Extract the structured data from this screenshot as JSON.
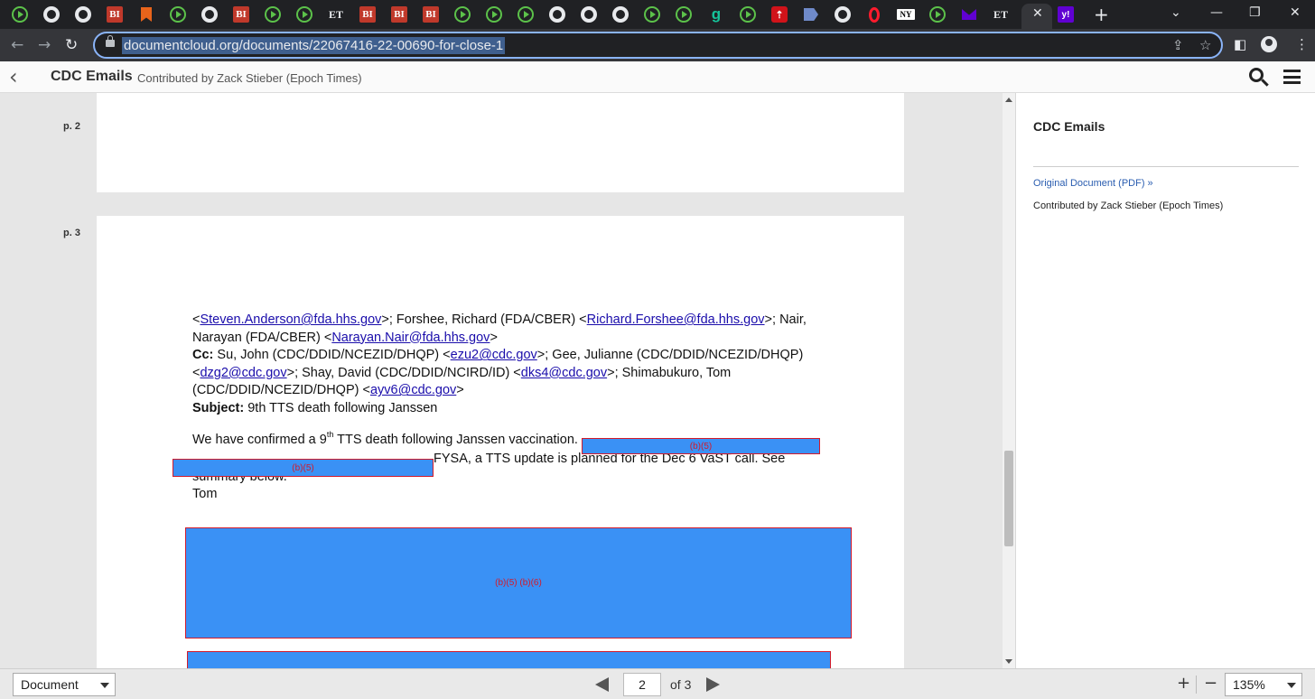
{
  "browser": {
    "url": "documentcloud.org/documents/22067416-22-00690-for-close-1",
    "tab_favicons": [
      "play",
      "globe",
      "globe",
      "bi",
      "bookmark",
      "play",
      "globe",
      "bi",
      "play",
      "play",
      "et",
      "bi",
      "bi",
      "bi",
      "play",
      "play",
      "play",
      "globe",
      "globe",
      "globe",
      "play",
      "play",
      "g",
      "play",
      "red-upload",
      "arrow",
      "globe",
      "opera",
      "nypost",
      "play",
      "mail",
      "et",
      "active",
      "yahoo"
    ],
    "tab_texts": {
      "bi": "BI",
      "et": "ET",
      "g": "g",
      "nypost": "NY",
      "yahoo": "y!"
    }
  },
  "header": {
    "title": "CDC Emails",
    "contributor": "Contributed by Zack Stieber (Epoch Times)"
  },
  "pages": {
    "page2_label": "p. 2",
    "page3_label": "p. 3"
  },
  "email": {
    "to_l1": {
      "p1": "<",
      "a1": "Steven.Anderson@fda.hhs.gov",
      "p2": ">; Forshee, Richard (FDA/CBER) <",
      "a2": "Richard.Forshee@fda.hhs.gov",
      "p3": ">; Nair,"
    },
    "to_l2": {
      "p1": "Narayan (FDA/CBER) <",
      "a1": "Narayan.Nair@fda.hhs.gov",
      "p2": ">"
    },
    "cc_l1": {
      "label": "Cc:",
      "p1": " Su, John (CDC/DDID/NCEZID/DHQP) <",
      "a1": "ezu2@cdc.gov",
      "p2": ">; Gee, Julianne (CDC/DDID/NCEZID/DHQP)"
    },
    "cc_l2": {
      "p1": "<",
      "a1": "dzg2@cdc.gov",
      "p2": ">; Shay, David (CDC/DDID/NCIRD/ID) <",
      "a2": "dks4@cdc.gov",
      "p3": ">; Shimabukuro, Tom"
    },
    "cc_l3": {
      "p1": "(CDC/DDID/NCEZID/DHQP) <",
      "a1": "ayv6@cdc.gov",
      "p2": ">"
    },
    "subject": {
      "label": "Subject:",
      "value": " 9th TTS death following Janssen"
    },
    "body_l1": {
      "p1": "We have confirmed a 9",
      "sup": "th",
      "p2": " TTS death following Janssen vaccination."
    },
    "body_l2": "FYSA, a TTS update is planned for the Dec 6 VaST call. See",
    "body_l3": "summary below.",
    "body_l4": "Tom"
  },
  "redactions": {
    "r1": "(b)(5)",
    "r2": "(b)(5)",
    "r3": "(b)(5)  (b)(6)"
  },
  "sidebar": {
    "title": "CDC Emails",
    "original_link": "Original Document (PDF) »",
    "contributor": "Contributed by Zack Stieber (Epoch Times)"
  },
  "footer": {
    "view_mode": "Document",
    "current_page": "2",
    "page_total": "of 3",
    "zoom": "135%"
  },
  "colors": {
    "redaction_fill": "#3a91f5",
    "redaction_border": "#d31a2a",
    "link": "#1a0dab"
  }
}
